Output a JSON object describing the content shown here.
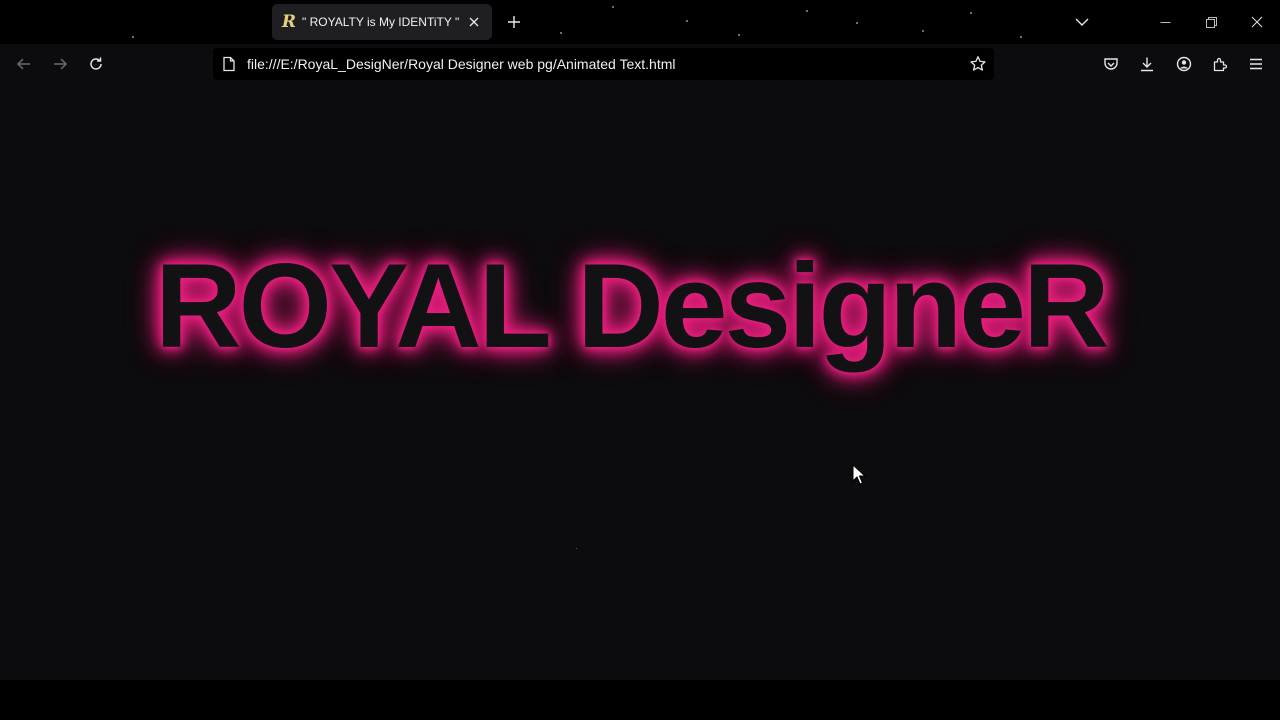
{
  "browser": {
    "tab": {
      "favicon_glyph": "R",
      "title": "\" ROYALTY is My IDENTiTY \""
    },
    "url": "file:///E:/RoyaL_DesigNer/Royal Designer web pg/Animated Text.html",
    "icons": {
      "tab_close": "close-icon",
      "new_tab": "plus-icon",
      "tab_list": "chevron-down-icon",
      "minimize": "minimize-icon",
      "restore": "restore-icon",
      "close_window": "close-icon",
      "back": "arrow-left-icon",
      "forward": "arrow-right-icon",
      "reload": "reload-icon",
      "page": "page-icon",
      "bookmark": "star-icon",
      "pocket": "pocket-icon",
      "downloads": "download-icon",
      "account": "account-icon",
      "extensions": "extensions-icon",
      "menu": "hamburger-menu-icon"
    }
  },
  "page": {
    "heading": "ROYAL DesigneR",
    "glow_color": "#e8207f",
    "text_color": "#121113",
    "background": "#0c0b0d"
  }
}
